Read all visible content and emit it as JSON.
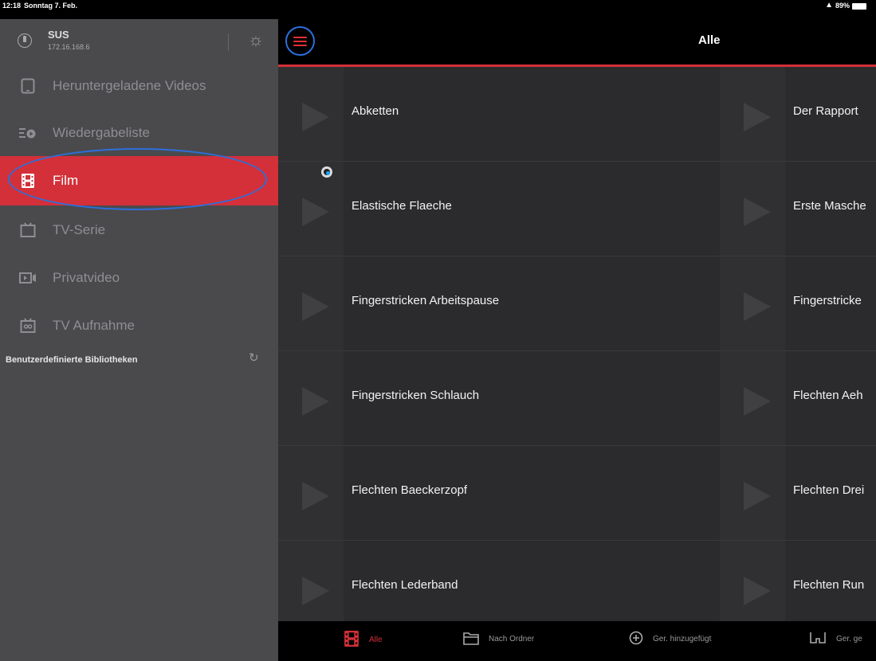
{
  "status": {
    "time": "12:18",
    "date": "Sonntag 7. Feb.",
    "battery": "89%"
  },
  "sidebar": {
    "user": {
      "name": "SUS",
      "ip": "172.16.168.6"
    },
    "items": [
      {
        "label": "Heruntergeladene Videos",
        "icon": "tablet-icon"
      },
      {
        "label": "Wiedergabeliste",
        "icon": "playlist-icon"
      },
      {
        "label": "Film",
        "icon": "film-icon",
        "active": true
      },
      {
        "label": "TV-Serie",
        "icon": "tv-icon"
      },
      {
        "label": "Privatvideo",
        "icon": "camera-icon"
      },
      {
        "label": "TV Aufnahme",
        "icon": "tv-recording-icon"
      }
    ],
    "section_title": "Benutzerdefinierte Bibliotheken"
  },
  "header": {
    "title": "Alle"
  },
  "videos": {
    "left": [
      "Abketten",
      "Elastische Flaeche",
      "Fingerstricken Arbeitspause",
      "Fingerstricken Schlauch",
      "Flechten Baeckerzopf",
      "Flechten Lederband"
    ],
    "right": [
      "Der Rapport",
      "Erste Masche",
      "Fingerstricke",
      "Flechten Aeh",
      "Flechten Drei",
      "Flechten Run"
    ]
  },
  "tabs": [
    {
      "label": "Alle",
      "icon": "film-icon"
    },
    {
      "label": "Nach Ordner",
      "icon": "folder-icon"
    },
    {
      "label": "Ger. hinzugefügt",
      "icon": "add-circle-icon"
    },
    {
      "label": "Ger. ge",
      "icon": "glasses-icon"
    }
  ],
  "colors": {
    "accent": "#d33039",
    "annotation": "#2d6fdc",
    "sidebar_bg": "#4a4a4c",
    "content_bg": "#2b2b2d"
  }
}
